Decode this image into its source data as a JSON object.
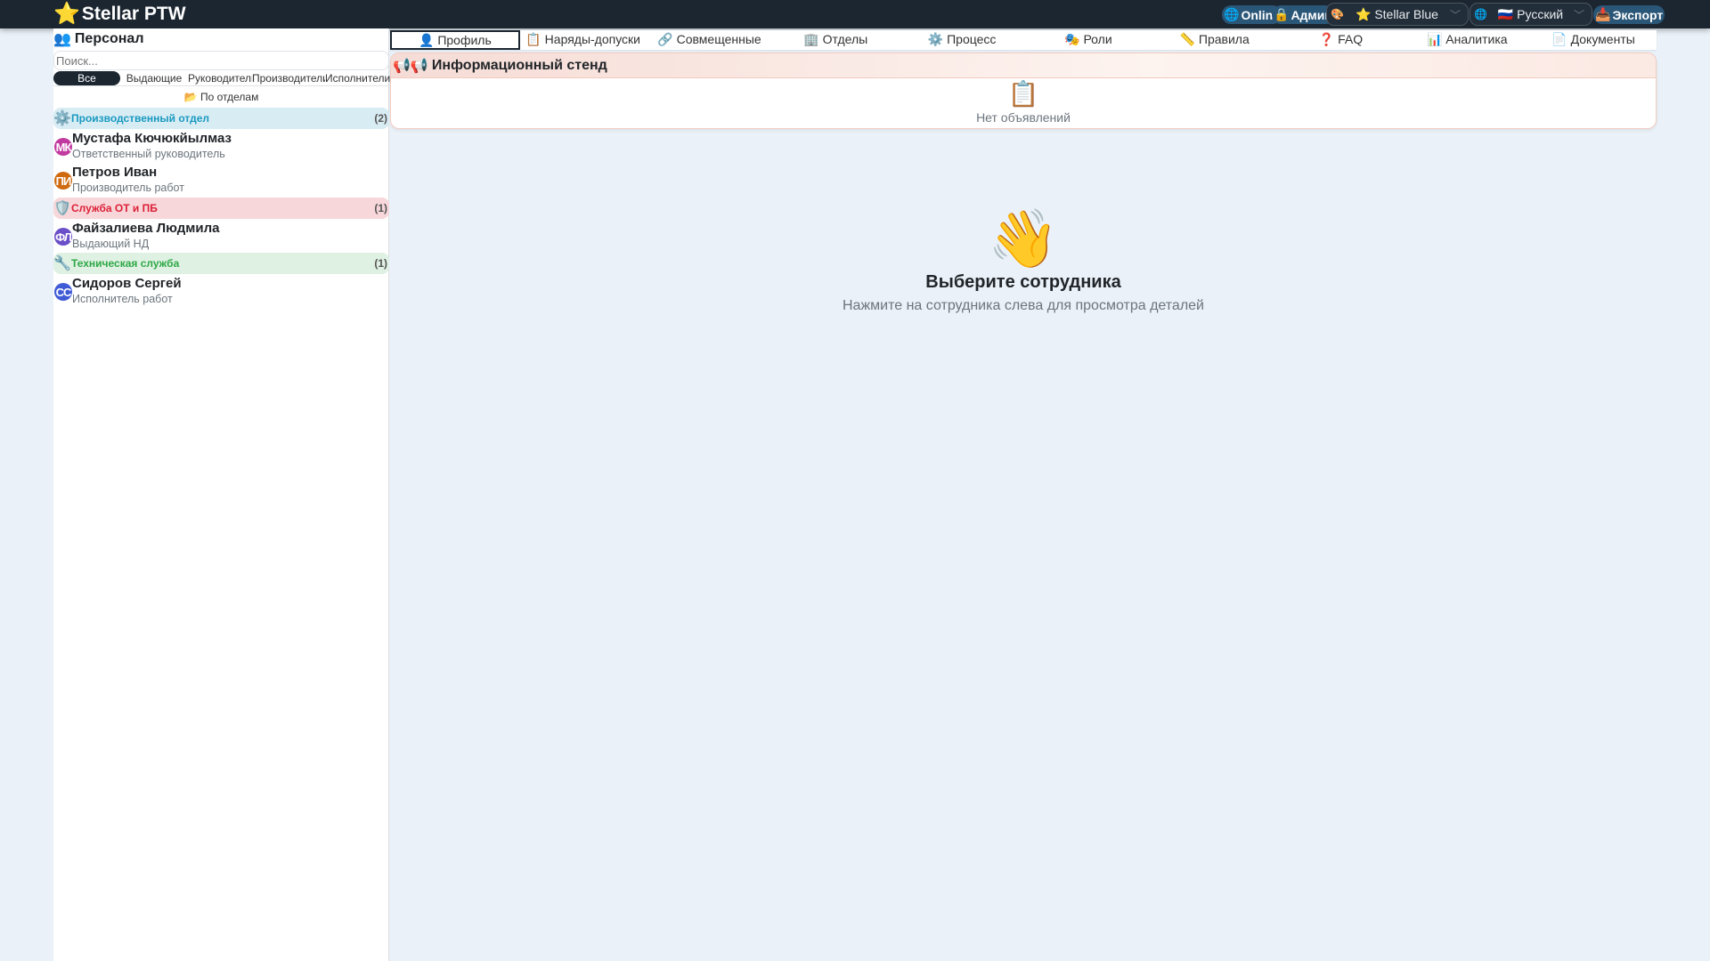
{
  "header": {
    "app_title": "Stellar PTW",
    "online_label": "Online",
    "admin_label": "Админ",
    "theme_select": {
      "value": "⭐ Stellar Blue"
    },
    "language_select": {
      "value": "🇷🇺 Русский"
    },
    "export_label": "Экспорт"
  },
  "sidebar": {
    "title": "Персонал",
    "search_placeholder": "Поиск...",
    "filters": [
      "Все",
      "Выдающие",
      "Руководители",
      "Производители",
      "Исполнители"
    ],
    "group_by_label": "По отделам",
    "departments": [
      {
        "name": "Производственный отдел",
        "count": "(2)",
        "color": "#1a9ac0",
        "people": [
          {
            "initials": "МК",
            "name": "Мустафа Кючюкйылмаз",
            "role": "Ответственный руководитель",
            "color": "#c13aa0"
          },
          {
            "initials": "ПИ",
            "name": "Петров Иван",
            "role": "Производитель работ",
            "color": "#d06a10"
          }
        ]
      },
      {
        "name": "Служба ОТ и ПБ",
        "count": "(1)",
        "color": "#dc1f36",
        "people": [
          {
            "initials": "ФЛ",
            "name": "Файзалиева Людмила",
            "role": "Выдающий НД",
            "color": "#6a4fc9"
          }
        ]
      },
      {
        "name": "Техническая служба",
        "count": "(1)",
        "color": "#2ea845",
        "people": [
          {
            "initials": "СС",
            "name": "Сидоров Сергей",
            "role": "Исполнитель работ",
            "color": "#3f5bd6"
          }
        ]
      }
    ]
  },
  "tabs": [
    "👤 Профиль",
    "📋 Наряды-допуски",
    "🔗 Совмещенные",
    "🏢 Отделы",
    "⚙️ Процесс",
    "🎭 Роли",
    "📏 Правила",
    "❓ FAQ",
    "📊 Аналитика",
    "📄 Документы"
  ],
  "board": {
    "title": "Информационный стенд",
    "empty_text": "Нет объявлений"
  },
  "placeholder": {
    "title": "Выберите сотрудника",
    "subtitle": "Нажмите на сотрудника слева для просмотра деталей"
  }
}
